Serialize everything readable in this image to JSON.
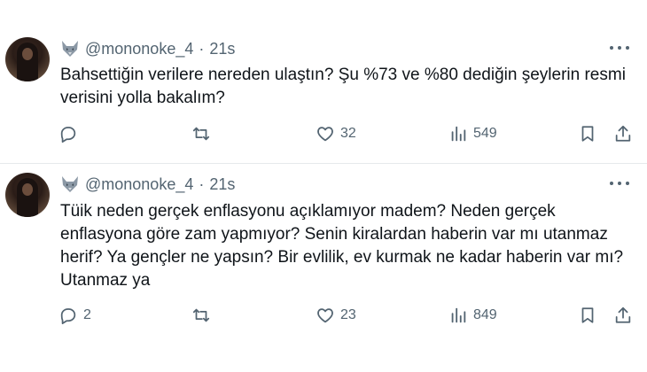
{
  "tweets": [
    {
      "handle": "@mononoke_4",
      "separator": "·",
      "time": "21s",
      "lines": [
        "Bahsettiğin verilere nereden ulaştın? Şu %73 ve %80 dediğin şeylerin resmi",
        "verisini yolla bakalım?"
      ],
      "replies": "",
      "retweets": "",
      "likes": "32",
      "views": "549"
    },
    {
      "handle": "@mononoke_4",
      "separator": "·",
      "time": "21s",
      "lines": [
        "Tüik neden gerçek enflasyonu açıklamıyor madem? Neden gerçek",
        "enflasyona göre zam yapmıyor? Senin kiralardan haberin var mı utanmaz",
        "herif? Ya gençler ne yapsın? Bir evlilik, ev kurmak ne kadar haberin var mı?",
        "Utanmaz ya"
      ],
      "replies": "2",
      "retweets": "",
      "likes": "23",
      "views": "849"
    }
  ],
  "icons": {
    "avatar_badge": "wolf-icon",
    "more": "more-icon",
    "reply": "reply-icon",
    "retweet": "retweet-icon",
    "like": "heart-icon",
    "views": "views-icon",
    "bookmark": "bookmark-icon",
    "share": "share-icon"
  },
  "colors": {
    "text": "#0f1419",
    "secondary": "#536471",
    "divider": "#e6e9ec"
  }
}
